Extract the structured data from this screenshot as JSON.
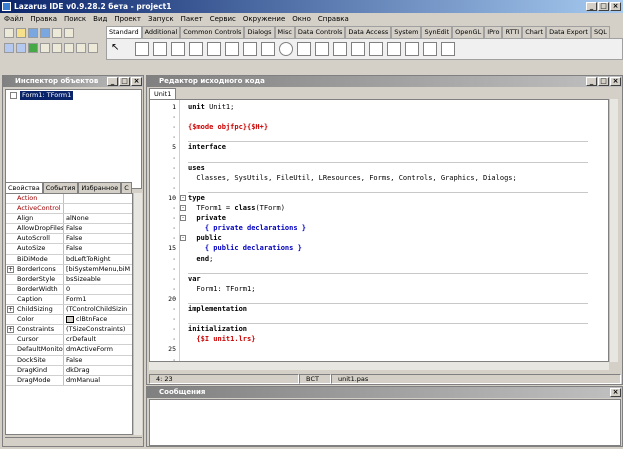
{
  "window": {
    "title": "Lazarus IDE v0.9.28.2 бета - project1"
  },
  "menu": [
    "Файл",
    "Правка",
    "Поиск",
    "Вид",
    "Проект",
    "Запуск",
    "Пакет",
    "Сервис",
    "Окружение",
    "Окно",
    "Справка"
  ],
  "palette_tabs": [
    "Standard",
    "Additional",
    "Common Controls",
    "Dialogs",
    "Misc",
    "Data Controls",
    "Data Access",
    "System",
    "SynEdit",
    "OpenGL",
    "IPro",
    "RTTI",
    "Chart",
    "Data Export",
    "SQL"
  ],
  "inspector": {
    "title": "Инспектор объектов",
    "tree_item": "Form1: TForm1",
    "tabs": [
      "Свойства",
      "События",
      "Избранное",
      "С"
    ],
    "properties": [
      {
        "name": "Action",
        "value": "",
        "style": "event"
      },
      {
        "name": "ActiveControl",
        "value": "",
        "style": "event"
      },
      {
        "name": "Align",
        "value": "alNone"
      },
      {
        "name": "AllowDropFiles",
        "value": "False"
      },
      {
        "name": "AutoScroll",
        "value": "False"
      },
      {
        "name": "AutoSize",
        "value": "False"
      },
      {
        "name": "BiDiMode",
        "value": "bdLeftToRight"
      },
      {
        "name": "BorderIcons",
        "value": "[biSystemMenu,biM",
        "expand": true
      },
      {
        "name": "BorderStyle",
        "value": "bsSizeable"
      },
      {
        "name": "BorderWidth",
        "value": "0"
      },
      {
        "name": "Caption",
        "value": "Form1"
      },
      {
        "name": "ChildSizing",
        "value": "(TControlChildSizin",
        "expand": true
      },
      {
        "name": "Color",
        "value": "clBtnFace",
        "swatch": true
      },
      {
        "name": "Constraints",
        "value": "(TSizeConstraints)",
        "expand": true
      },
      {
        "name": "Cursor",
        "value": "crDefault"
      },
      {
        "name": "DefaultMonitor",
        "value": "dmActiveForm"
      },
      {
        "name": "DockSite",
        "value": "False"
      },
      {
        "name": "DragKind",
        "value": "dkDrag"
      },
      {
        "name": "DragMode",
        "value": "dmManual"
      }
    ]
  },
  "editor": {
    "title": "Редактор исходного кода",
    "tab": "Unit1",
    "line_numbers": [
      {
        "n": "1",
        "line": 0
      },
      {
        "n": "5",
        "line": 4
      },
      {
        "n": "10",
        "line": 9
      },
      {
        "n": "15",
        "line": 14
      },
      {
        "n": "20",
        "line": 19
      },
      {
        "n": "25",
        "line": 24
      }
    ],
    "lines": [
      [
        {
          "t": "unit",
          "c": "kw"
        },
        {
          "t": " Unit1;",
          "c": ""
        }
      ],
      [],
      [
        {
          "t": "{$mode objfpc}{$H+}",
          "c": "dir"
        }
      ],
      [],
      [
        {
          "t": "interface",
          "c": "kw"
        }
      ],
      [],
      [
        {
          "t": "uses",
          "c": "kw"
        }
      ],
      [
        {
          "t": "  Classes, SysUtils, FileUtil, LResources, Forms, Controls, Graphics, Dialogs;",
          "c": ""
        }
      ],
      [],
      [
        {
          "t": "type",
          "c": "kw"
        }
      ],
      [
        {
          "t": "  TForm1 = ",
          "c": ""
        },
        {
          "t": "class",
          "c": "kw"
        },
        {
          "t": "(TForm)",
          "c": ""
        }
      ],
      [
        {
          "t": "  private",
          "c": "kw"
        }
      ],
      [
        {
          "t": "    { private declarations }",
          "c": "cm"
        }
      ],
      [
        {
          "t": "  public",
          "c": "kw"
        }
      ],
      [
        {
          "t": "    { public declarations }",
          "c": "cm"
        }
      ],
      [
        {
          "t": "  end",
          "c": "kw"
        },
        {
          "t": ";",
          "c": ""
        }
      ],
      [],
      [
        {
          "t": "var",
          "c": "kw"
        }
      ],
      [
        {
          "t": "  Form1: TForm1;",
          "c": ""
        }
      ],
      [],
      [
        {
          "t": "implementation",
          "c": "kw"
        }
      ],
      [],
      [
        {
          "t": "initialization",
          "c": "kw"
        }
      ],
      [
        {
          "t": "  {$I unit1.lrs}",
          "c": "dir"
        }
      ],
      [],
      []
    ],
    "status": {
      "position": "4: 23",
      "mode": "ВСТ",
      "file": "unit1.pas"
    }
  },
  "messages": {
    "title": "Сообщения"
  }
}
